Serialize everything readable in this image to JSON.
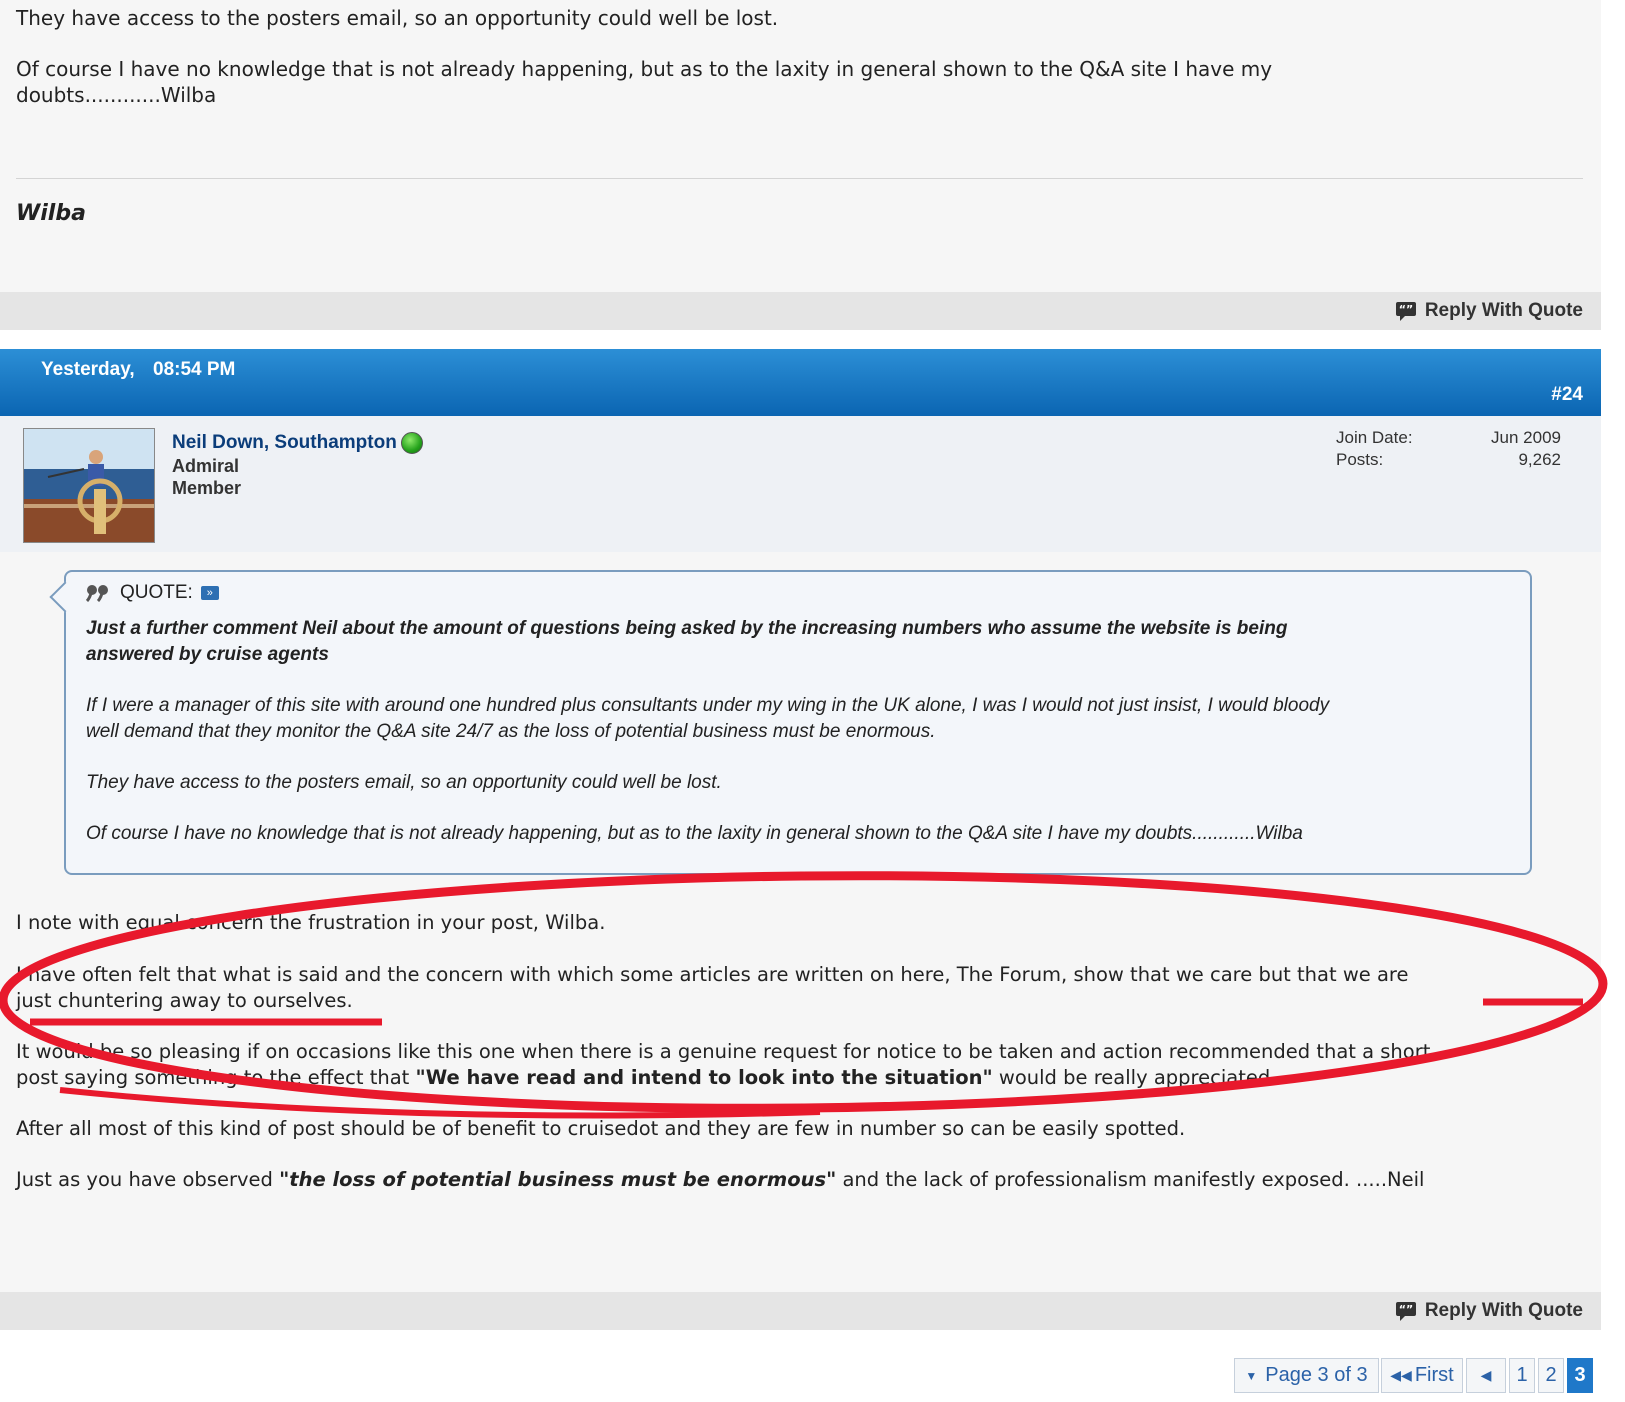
{
  "post1": {
    "paragraphs": [
      "They have access to the posters email, so an opportunity could well be lost.",
      "Of course I have no knowledge that is not already happening, but as to the laxity in general shown to the Q&A site I have my",
      "doubts............Wilba"
    ],
    "signature": "Wilba",
    "reply_with_quote": "Reply With Quote"
  },
  "post2": {
    "date": "Yesterday,",
    "time": "08:54 PM",
    "post_number": "#24",
    "user": {
      "name": "Neil Down, Southampton",
      "rank": "Admiral",
      "group": "Member",
      "join_date_label": "Join Date:",
      "join_date": "Jun 2009",
      "posts_label": "Posts:",
      "posts": "9,262"
    },
    "quote": {
      "label": "QUOTE:",
      "lines": [
        "Just a further comment Neil about the amount of questions being asked by the increasing numbers who assume the website is being",
        "answered by cruise agents",
        "If I were a manager of this site with around one hundred plus consultants under my wing in the UK alone, I was I would not just insist, I would bloody",
        "well demand that they monitor the Q&A site 24/7 as the loss of potential business must be enormous.",
        "They have access to the posters email, so an opportunity could well be lost.",
        "Of course I have no knowledge that is not already happening, but as to the laxity in general shown to the Q&A site I have my doubts............Wilba"
      ]
    },
    "body": {
      "p1": "I note with equal concern the frustration in your post, Wilba.",
      "p2a": "I have often felt that what is said and the concern with which some articles are written on here, The Forum, show that we care but that we are",
      "p2b": "just chuntering away to ourselves.",
      "p3a": "It would be so pleasing if on occasions like this one when there is a genuine request for notice to be taken and action recommended that a short",
      "p3b_pre": "post saying something to the effect that ",
      "p3b_bold": "\"We have read and intend to look into the situation\"",
      "p3b_post": " would be really appreciated.",
      "p4": "After all most of this kind of post should be of benefit to cruisedot and they are few in number so can be easily spotted.",
      "p5_pre": "Just as you have observed ",
      "p5_bold": "\"the loss of potential business must be enormous\"",
      "p5_post": " and the lack of professionalism manifestly exposed. .....Neil"
    },
    "reply_with_quote": "Reply With Quote"
  },
  "pagination": {
    "page_label": "Page 3 of 3",
    "first_label": "First",
    "pages": [
      "1",
      "2",
      "3"
    ],
    "current": "3"
  },
  "colors": {
    "header_blue": "#0b65b2",
    "annotation_red": "#e8192c",
    "link_blue": "#2b62a8"
  }
}
